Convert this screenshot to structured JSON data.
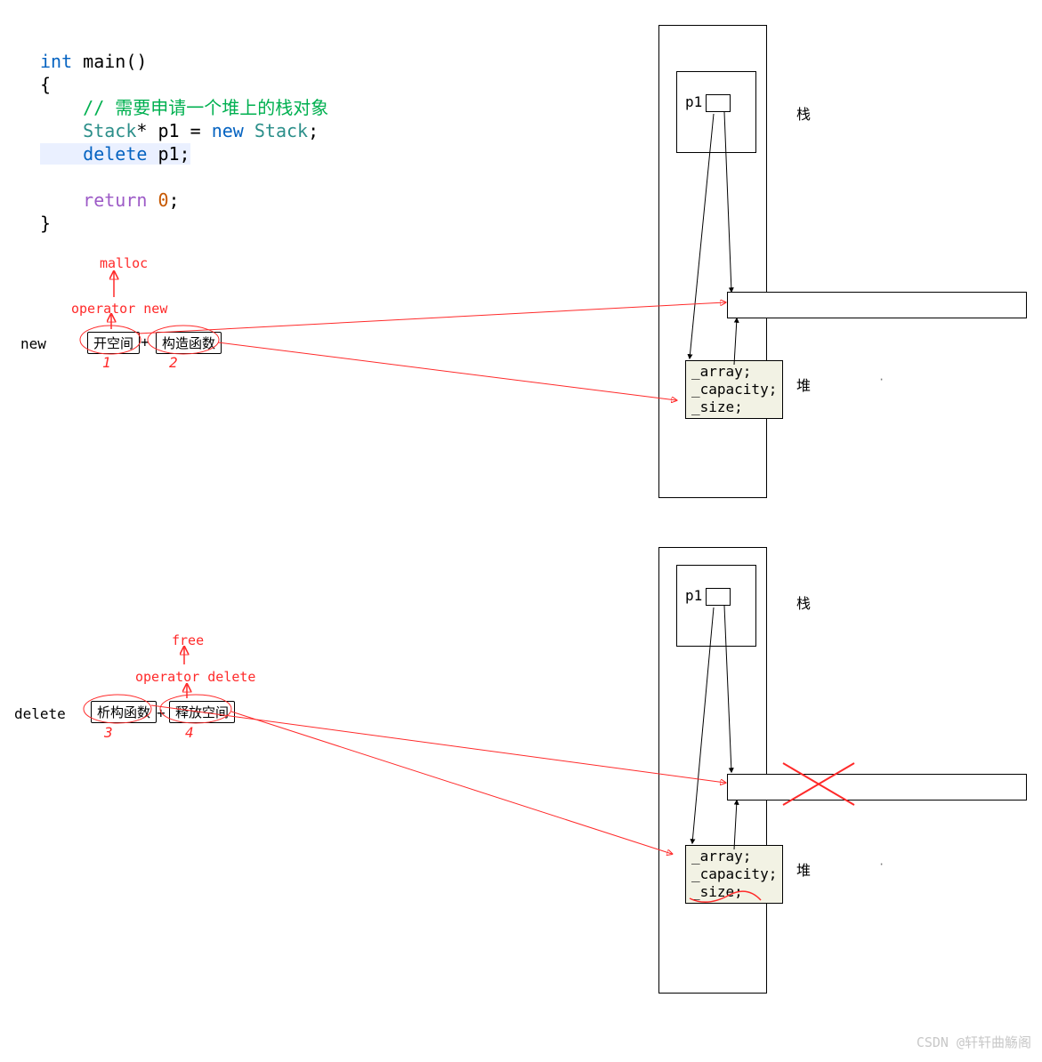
{
  "code": {
    "l1": "int main()",
    "l1_kw": "int",
    "l1_rest": " main()",
    "l2": "{",
    "l3": "    // 需要申请一个堆上的栈对象",
    "l4_a": "    Stack* p1 = ",
    "l4_new": "new",
    "l4_b": " Stack;",
    "l4_stack": "Stack",
    "l5": "    delete p1;",
    "l5_kw": "delete",
    "l5_rest": " p1;",
    "l6": "",
    "l7": "    return 0;",
    "l7_kw": "return",
    "l7_num": "0",
    "l8": "}"
  },
  "anno": {
    "malloc": "malloc",
    "opnew": "operator new",
    "new": "new",
    "alloc": "开空间",
    "ctor": "构造函数",
    "delete": "delete",
    "dtor": "析构函数",
    "release": "释放空间",
    "free": "free",
    "opdelete": "operator delete",
    "plus": "+",
    "plus2": "+",
    "n1": "1",
    "n2": "2",
    "n3": "3",
    "n4": "4"
  },
  "mem": {
    "p1": "p1",
    "stack": "栈",
    "heap": "堆",
    "f1": "_array;",
    "f2": "_capacity;",
    "f3": "_size;"
  },
  "watermark": "CSDN @轩轩曲觞阁"
}
